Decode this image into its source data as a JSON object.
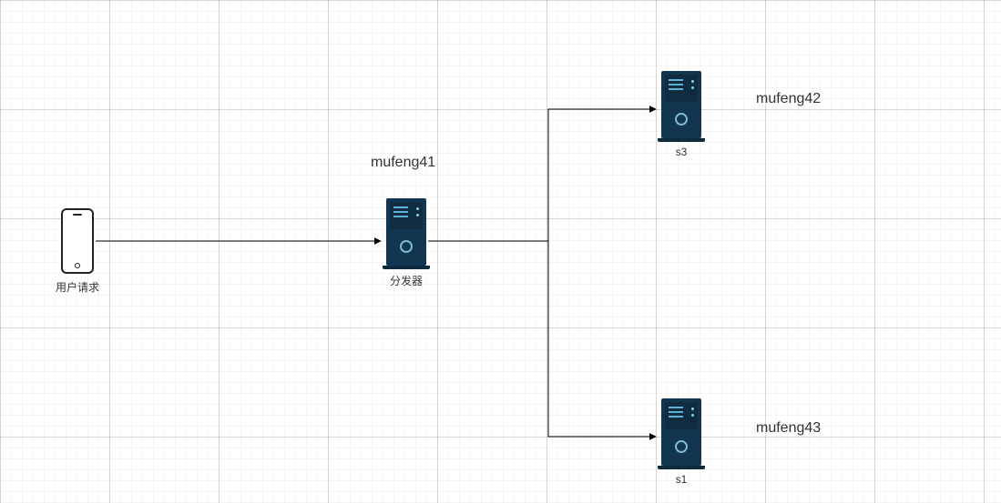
{
  "nodes": {
    "client": {
      "caption": "用户请求"
    },
    "dispatcher": {
      "title": "mufeng41",
      "caption": "分发器"
    },
    "server_top": {
      "title": "mufeng42",
      "caption": "s3"
    },
    "server_bottom": {
      "title": "mufeng43",
      "caption": "s1"
    }
  },
  "chart_data": {
    "type": "diagram",
    "nodes": [
      {
        "id": "client",
        "label": "用户请求",
        "kind": "phone"
      },
      {
        "id": "dispatcher",
        "label": "分发器",
        "title": "mufeng41",
        "kind": "server"
      },
      {
        "id": "s3",
        "label": "s3",
        "title": "mufeng42",
        "kind": "server"
      },
      {
        "id": "s1",
        "label": "s1",
        "title": "mufeng43",
        "kind": "server"
      }
    ],
    "edges": [
      {
        "from": "client",
        "to": "dispatcher",
        "directed": true
      },
      {
        "from": "dispatcher",
        "to": "s3",
        "directed": true
      },
      {
        "from": "dispatcher",
        "to": "s1",
        "directed": true
      }
    ]
  }
}
